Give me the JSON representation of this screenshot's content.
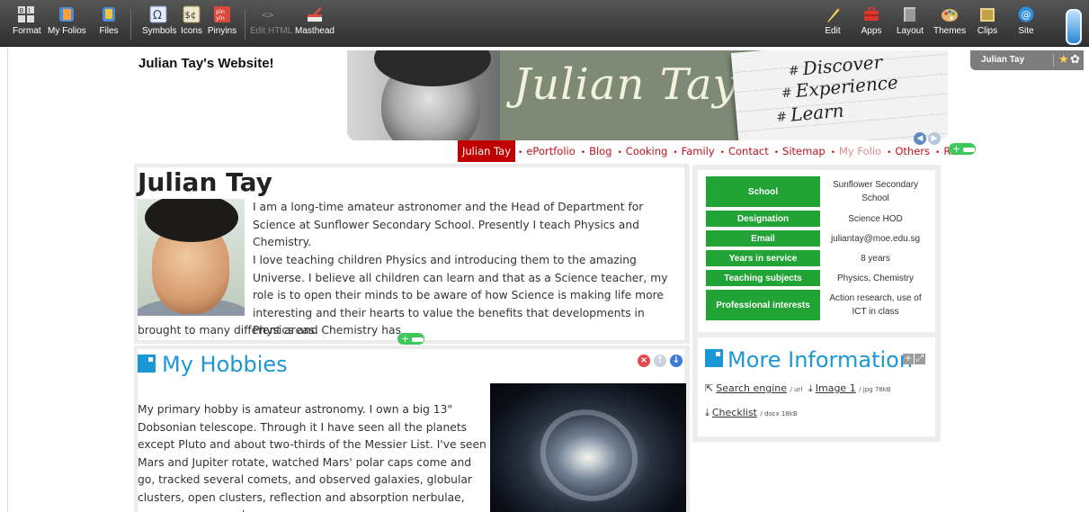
{
  "toolbar": {
    "left": [
      {
        "label": "Format",
        "icon": "format-icon"
      },
      {
        "label": "My Folios",
        "icon": "folios-icon"
      },
      {
        "label": "Files",
        "icon": "files-icon"
      },
      {
        "label": "Symbols",
        "icon": "symbols-icon"
      },
      {
        "label": "Icons",
        "icon": "icons-icon"
      },
      {
        "label": "Pinyins",
        "icon": "pinyin-icon"
      },
      {
        "label": "Edit HTML",
        "icon": "edit-html-icon"
      },
      {
        "label": "Masthead",
        "icon": "masthead-icon"
      }
    ],
    "right": [
      {
        "label": "Edit",
        "icon": "pencil-icon"
      },
      {
        "label": "Apps",
        "icon": "toolbox-icon"
      },
      {
        "label": "Layout",
        "icon": "layout-icon"
      },
      {
        "label": "Themes",
        "icon": "palette-icon"
      },
      {
        "label": "Clips",
        "icon": "clips-icon"
      },
      {
        "label": "Site",
        "icon": "site-icon"
      }
    ],
    "glyphs": {
      "symbols": "Ω",
      "icons": "$¢",
      "pinyin_top": "pīn",
      "pinyin_bottom": "yīn",
      "edit_html": "<>"
    }
  },
  "site": {
    "title": "Julian Tay's Website!"
  },
  "folio_badge": {
    "name": "Julian Tay"
  },
  "masthead": {
    "name": "Julian Tay",
    "words": [
      "Discover",
      "Experience",
      "Learn"
    ],
    "hash": "#"
  },
  "nav": {
    "items": [
      {
        "label": "Julian Tay",
        "state": "active"
      },
      {
        "label": "ePortfolio",
        "state": "normal"
      },
      {
        "label": "Blog",
        "state": "normal"
      },
      {
        "label": "Cooking",
        "state": "normal"
      },
      {
        "label": "Family",
        "state": "normal"
      },
      {
        "label": "Contact",
        "state": "normal"
      },
      {
        "label": "Sitemap",
        "state": "normal"
      },
      {
        "label": "My Folio",
        "state": "faint"
      },
      {
        "label": "Others",
        "state": "normal"
      },
      {
        "label": "RSS",
        "state": "normal"
      }
    ],
    "bullet": "•"
  },
  "intro": {
    "heading": "Julian Tay",
    "p1": "I am a long-time amateur astronomer and the Head of Department for Science at Sunflower Secondary School. Presently I teach Physics and Chemistry.",
    "p2": "I love teaching children Physics and introducing them to the amazing Universe. I believe all children can learn and that as a Science teacher, my role is to open their minds to be aware of how Science is making life more interesting and their hearts to value the benefits that developments in Physics and Chemistry has",
    "p3": "brought to many different areas."
  },
  "info_table": [
    {
      "key": "School",
      "value": "Sunflower Secondary School"
    },
    {
      "key": "Designation",
      "value": "Science HOD"
    },
    {
      "key": "Email",
      "value": "juliantay@moe.edu.sg"
    },
    {
      "key": "Years in service",
      "value": "8 years"
    },
    {
      "key": "Teaching subjects",
      "value": "Physics, Chemistry"
    },
    {
      "key": "Professional interests",
      "value": "Action research, use of ICT in class"
    }
  ],
  "hobbies": {
    "title": "My Hobbies",
    "text": "My primary hobby is amateur astronomy. I own a big 13\" Dobsonian telescope. Through it I have seen all the planets except Pluto and about two-thirds of the Messier List. I've seen Mars and Jupiter rotate, watched Mars' polar caps come and go, tracked several comets, and observed galaxies, globular clusters, open clusters, reflection and absorption nerbulae, supernova remnants,"
  },
  "more_info": {
    "title": "More Information",
    "links": [
      {
        "label": "Search engine",
        "meta": "/ url",
        "icon": "external-link-icon"
      },
      {
        "label": "Image 1",
        "meta": "/ jpg 78kB",
        "icon": "download-icon"
      },
      {
        "label": "Checklist",
        "meta": "/ docx 18kB",
        "icon": "download-icon"
      }
    ]
  },
  "colors": {
    "accent_green": "#21a335",
    "accent_blue": "#1c97d6",
    "nav_red": "#c0101f",
    "nav_active": "#c00000"
  }
}
